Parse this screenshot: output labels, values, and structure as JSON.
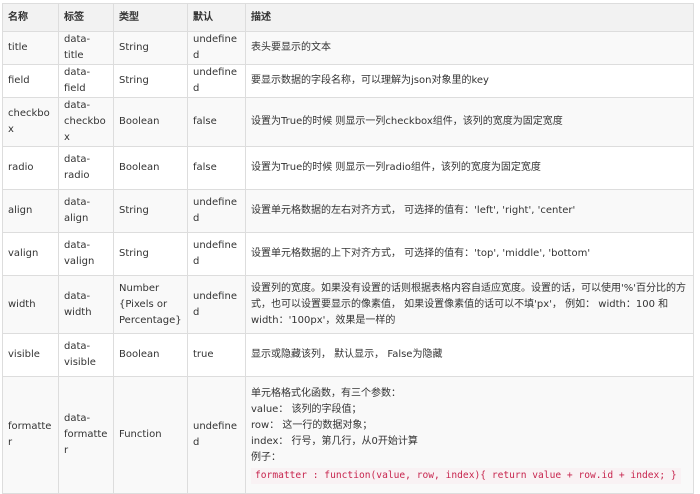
{
  "table": {
    "headers": [
      "名称",
      "标签",
      "类型",
      "默认",
      "描述"
    ],
    "rows": [
      {
        "name": "title",
        "tag": "data-title",
        "type": "String",
        "default": "undefined",
        "desc": [
          "表头要显示的文本"
        ]
      },
      {
        "name": "field",
        "tag": "data-field",
        "type": "String",
        "default": "undefined",
        "desc": [
          "要显示数据的字段名称，可以理解为json对象里的key"
        ]
      },
      {
        "name": "checkbox",
        "tag": "data-checkbox",
        "type": "Boolean",
        "default": "false",
        "desc": [
          "设置为True的时候 则显示一列checkbox组件，该列的宽度为固定宽度"
        ]
      },
      {
        "name": "radio",
        "tag": "data-radio",
        "type": "Boolean",
        "default": "false",
        "desc": [
          "设置为True的时候 则显示一列radio组件，该列的宽度为固定宽度"
        ]
      },
      {
        "name": "align",
        "tag": "data-align",
        "type": "String",
        "default": "undefined",
        "desc": [
          "设置单元格数据的左右对齐方式， 可选择的值有：'left', 'right', 'center'"
        ]
      },
      {
        "name": "valign",
        "tag": "data-valign",
        "type": "String",
        "default": "undefined",
        "desc": [
          "设置单元格数据的上下对齐方式， 可选择的值有：'top', 'middle', 'bottom'"
        ]
      },
      {
        "name": "width",
        "tag": "data-width",
        "type": "Number {Pixels or Percentage}",
        "default": "undefined",
        "desc": [
          "设置列的宽度。如果没有设置的话则根据表格内容自适应宽度。设置的话，可以使用'%'百分比的方式，也可以设置要显示的像素值， 如果设置像素值的话可以不填'px'， 例如： width：100 和 width：'100px'，效果是一样的"
        ]
      },
      {
        "name": "visible",
        "tag": "data-visible",
        "type": "Boolean",
        "default": "true",
        "desc": [
          "显示或隐藏该列， 默认显示， False为隐藏"
        ]
      },
      {
        "name": "formatter",
        "tag": "data-formatter",
        "type": "Function",
        "default": "undefined",
        "desc": [
          "单元格格式化函数，有三个参数：",
          "value： 该列的字段值；",
          "row： 这一行的数据对象；",
          "index： 行号，第几行，从0开始计算",
          "例子："
        ],
        "code": "formatter : function(value, row, index){ return value + row.id + index; }"
      }
    ]
  }
}
